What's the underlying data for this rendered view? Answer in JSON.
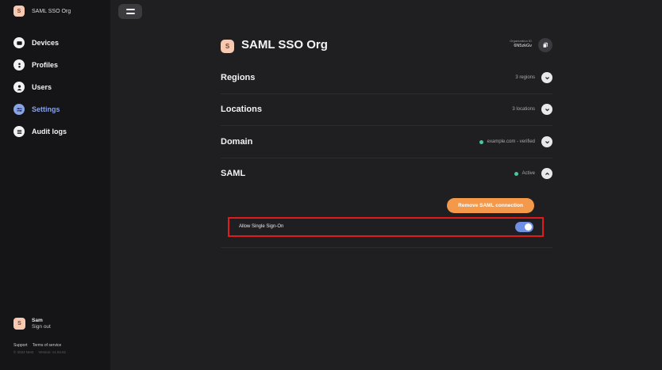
{
  "sidebar": {
    "org_initial": "S",
    "org_name": "SAML SSO Org",
    "nav": [
      {
        "label": "Devices",
        "icon": "device-icon",
        "active": false
      },
      {
        "label": "Profiles",
        "icon": "profile-icon",
        "active": false
      },
      {
        "label": "Users",
        "icon": "user-icon",
        "active": false
      },
      {
        "label": "Settings",
        "icon": "settings-icon",
        "active": true
      },
      {
        "label": "Audit logs",
        "icon": "audit-log-icon",
        "active": false
      }
    ],
    "user": {
      "initial": "S",
      "name": "Sam",
      "signout": "Sign out"
    },
    "footer_links": [
      "Support",
      "Terms of service"
    ],
    "footer_meta": [
      "© 2024 Nest",
      "Version: v1.04.61"
    ]
  },
  "main": {
    "org_initial": "S",
    "org_title": "SAML SSO Org",
    "org_id_label": "Organization ID",
    "org_id_value": "6N5zkGv",
    "sections": [
      {
        "title": "Regions",
        "status": "3 regions",
        "has_dot": false
      },
      {
        "title": "Locations",
        "status": "3 locations",
        "has_dot": false
      },
      {
        "title": "Domain",
        "status": "example.com - verified",
        "has_dot": true
      },
      {
        "title": "SAML",
        "status": "Active",
        "has_dot": true
      }
    ],
    "saml": {
      "remove_label": "Remove SAML connection",
      "sso_label": "Allow Single Sign-On",
      "sso_enabled": true
    }
  },
  "colors": {
    "accent": "#8aa4e8",
    "toggle_on": "#6f8fe2",
    "status_green": "#48c79a",
    "danger_button": "#f4994a",
    "highlight_border": "#e01b1b"
  }
}
